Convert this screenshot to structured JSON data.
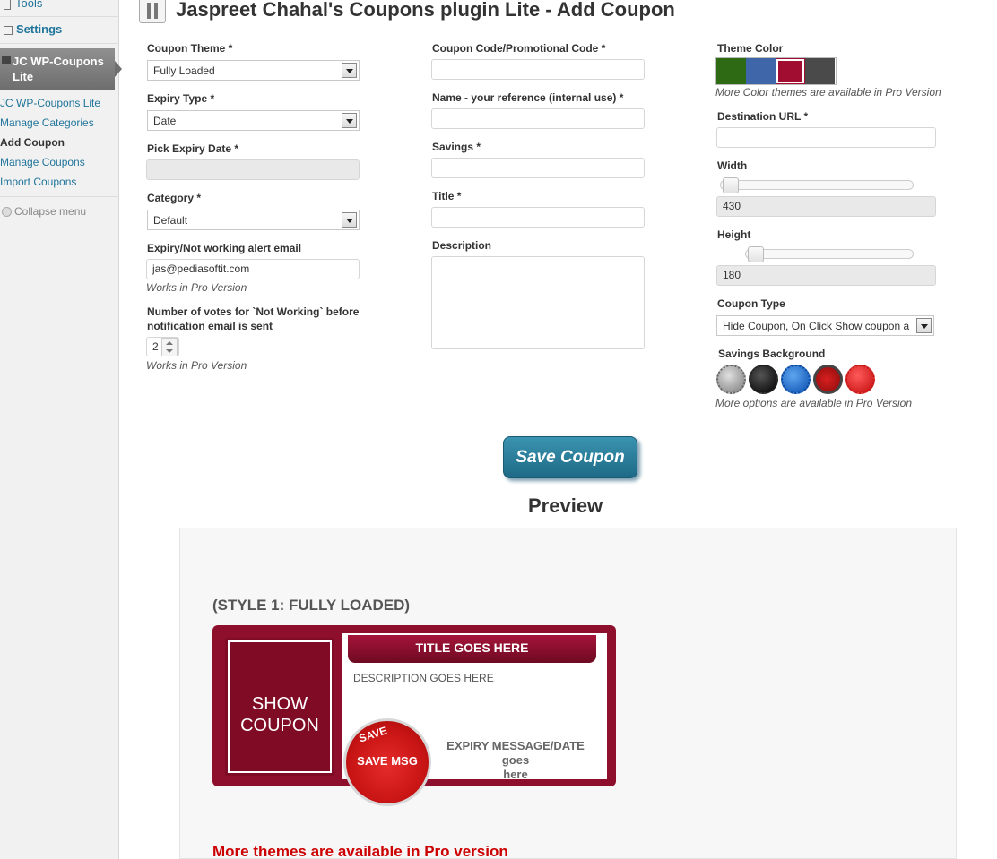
{
  "sidebar": {
    "tools_label": "Tools",
    "settings_label": "Settings",
    "active_menu_label": "JC WP-Coupons Lite",
    "submenu": [
      {
        "label": "JC WP-Coupons Lite"
      },
      {
        "label": "Manage Categories"
      },
      {
        "label": "Add Coupon"
      },
      {
        "label": "Manage Coupons"
      },
      {
        "label": "Import Coupons"
      }
    ],
    "collapse_label": "Collapse menu"
  },
  "header": {
    "title": "Jaspreet Chahal's Coupons plugin Lite - Add Coupon"
  },
  "form": {
    "coupon_theme": {
      "label": "Coupon Theme *",
      "value": "Fully Loaded"
    },
    "expiry_type": {
      "label": "Expiry Type *",
      "value": "Date"
    },
    "pick_expiry_date": {
      "label": "Pick Expiry Date *",
      "value": ""
    },
    "category": {
      "label": "Category *",
      "value": "Default"
    },
    "alert_email": {
      "label": "Expiry/Not working alert email",
      "value": "jas@pediasoftit.com",
      "note": "Works in Pro Version"
    },
    "votes": {
      "label_line1": "Number of votes for `Not Working` before",
      "label_line2": "notification email is sent",
      "value": "2",
      "note": "Works in Pro Version"
    },
    "coupon_code": {
      "label": "Coupon Code/Promotional Code *",
      "value": ""
    },
    "name": {
      "label": "Name - your reference (internal use) *",
      "value": ""
    },
    "savings": {
      "label": "Savings *",
      "value": ""
    },
    "title": {
      "label": "Title *",
      "value": ""
    },
    "description": {
      "label": "Description",
      "value": ""
    },
    "theme_color": {
      "label": "Theme Color",
      "colors": [
        "#2d6a13",
        "#3f66a8",
        "#a10d30",
        "#4a4a4a"
      ],
      "note": "More Color themes are available in Pro Version"
    },
    "destination_url": {
      "label": "Destination URL *",
      "value": ""
    },
    "width": {
      "label": "Width",
      "value": "430"
    },
    "height": {
      "label": "Height",
      "value": "180"
    },
    "coupon_type": {
      "label": "Coupon Type",
      "value": "Hide Coupon, On Click Show coupon a"
    },
    "savings_background": {
      "label": "Savings Background",
      "note": "More options are available in Pro Version"
    },
    "save_button": "Save Coupon"
  },
  "preview": {
    "heading": "Preview",
    "style_label": "(STYLE 1: FULLY LOADED)",
    "show_coupon_line1": "SHOW",
    "show_coupon_line2": "COUPON",
    "title_text": "TITLE GOES HERE",
    "description_text": "DESCRIPTION GOES HERE",
    "save_badge_top": "SAVE",
    "save_msg": "SAVE MSG",
    "expiry_line1": "EXPIRY MESSAGE/DATE goes",
    "expiry_line2": "here",
    "more_themes": "More themes are available in Pro version"
  }
}
